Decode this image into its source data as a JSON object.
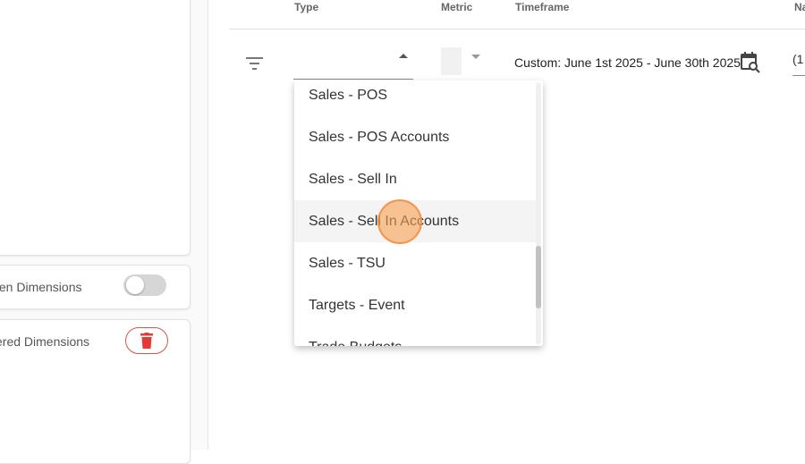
{
  "left_panel": {
    "row1_label": "ten Dimensions",
    "row2_label": "ered Dimensions"
  },
  "header": {
    "type": "Type",
    "metric": "Metric",
    "timeframe": "Timeframe",
    "name": "Na"
  },
  "filter": {
    "timeframe_value": "Custom: June 1st 2025 - June 30th 2025",
    "name_value": "(1"
  },
  "dropdown": {
    "options": [
      "Sales - POS",
      "Sales - POS Accounts",
      "Sales - Sell In",
      "Sales - Sell In Accounts",
      "Sales - TSU",
      "Targets - Event",
      "Trade Budgets"
    ]
  },
  "colors": {
    "delete": "#e53935",
    "click_indicator": "#f6a050"
  }
}
